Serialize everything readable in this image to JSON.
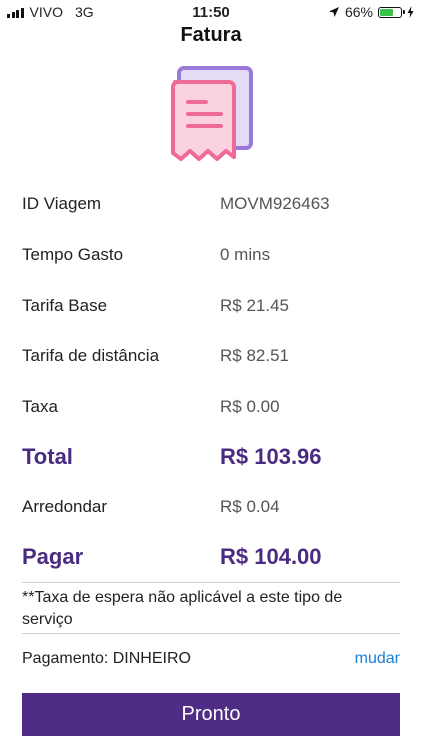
{
  "status_bar": {
    "carrier": "VIVO",
    "network": "3G",
    "time": "11:50",
    "battery_percent": "66%",
    "battery_level": 0.66,
    "icons": [
      "signal-icon",
      "location-arrow-icon",
      "battery-icon",
      "charging-bolt-icon"
    ]
  },
  "header": {
    "title": "Fatura"
  },
  "illustration": {
    "icon": "receipt-icon",
    "colors": {
      "front": "#f06a96",
      "back": "#9a7ad8"
    }
  },
  "invoice": {
    "rows": [
      {
        "label": "ID Viagem",
        "value": "MOVM926463"
      },
      {
        "label": "Tempo Gasto",
        "value": "0 mins"
      },
      {
        "label": "Tarifa Base",
        "value": "R$ 21.45"
      },
      {
        "label": "Tarifa de distância",
        "value": "R$ 82.51"
      },
      {
        "label": "Taxa",
        "value": "R$ 0.00"
      }
    ],
    "total": {
      "label": "Total",
      "value": "R$ 103.96"
    },
    "rounding": {
      "label": "Arredondar",
      "value": "R$ 0.04"
    },
    "pay": {
      "label": "Pagar",
      "value": "R$ 104.00"
    }
  },
  "note": "**Taxa de espera não aplicável a este tipo de serviço",
  "payment": {
    "label": "Pagamento: DINHEIRO",
    "change_link": "mudar"
  },
  "actions": {
    "done_label": "Pronto"
  },
  "colors": {
    "accent": "#4f2c85",
    "link": "#1a7fd4",
    "battery": "#3ac34a"
  }
}
